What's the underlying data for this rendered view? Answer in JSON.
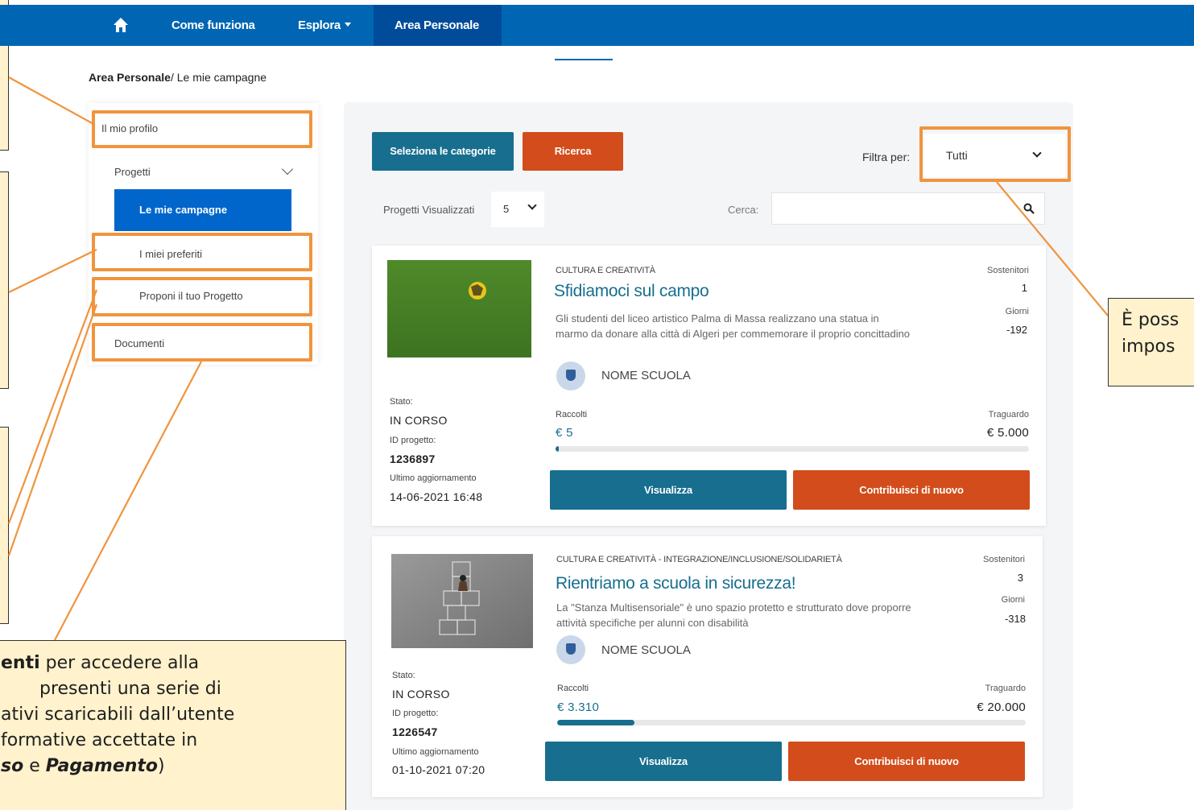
{
  "nav": {
    "home_icon": "home-icon",
    "items": [
      {
        "label": "Come funziona"
      },
      {
        "label": "Esplora"
      },
      {
        "label": "Area Personale"
      }
    ]
  },
  "breadcrumb": {
    "parent": "Area Personale",
    "sep": "/ ",
    "current": "Le mie campagne"
  },
  "sidebar": {
    "items": [
      {
        "label": "Il mio profilo"
      },
      {
        "label": "Progetti"
      },
      {
        "label": "Le mie campagne"
      },
      {
        "label": "I miei preferiti"
      },
      {
        "label": "Proponi il tuo Progetto"
      },
      {
        "label": "Documenti"
      }
    ]
  },
  "toolbar": {
    "categories_button": "Seleziona le categorie",
    "search_button": "Ricerca",
    "filter_label": "Filtra per:",
    "filter_value": "Tutti",
    "shown_label": "Progetti Visualizzati",
    "shown_value": "5",
    "search_label": "Cerca:",
    "search_placeholder": ""
  },
  "projects": [
    {
      "category": "CULTURA E CREATIVITÀ",
      "title": "Sfidiamoci sul campo",
      "description": "Gli studenti del liceo artistico Palma di Massa realizzano una statua in marmo da donare alla città di Algeri per commemorare il proprio concittadino",
      "school": "NOME SCUOLA",
      "supporters_label": "Sostenitori",
      "supporters": "1",
      "days_label": "Giorni",
      "days": "-192",
      "state_label": "Stato:",
      "state": "IN CORSO",
      "id_label": "ID progetto:",
      "id": "1236897",
      "updated_label": "Ultimo aggiornamento",
      "updated": "14-06-2021 16:48",
      "raised_label": "Raccolti",
      "raised": "€ 5",
      "goal_label": "Traguardo",
      "goal": "€ 5.000",
      "progress": 0.001,
      "view_button": "Visualizza",
      "contribute_button": "Contribuisci di nuovo"
    },
    {
      "category": "CULTURA E CREATIVITÀ - INTEGRAZIONE/INCLUSIONE/SOLIDARIETÀ",
      "title": "Rientriamo a scuola in sicurezza!",
      "description": "La \"Stanza Multisensoriale\" è uno spazio protetto e strutturato dove proporre attività specifiche per alunni con disabilità",
      "school": "NOME SCUOLA",
      "supporters_label": "Sostenitori",
      "supporters": "3",
      "days_label": "Giorni",
      "days": "-318",
      "state_label": "Stato:",
      "state": "IN CORSO",
      "id_label": "ID progetto:",
      "id": "1226547",
      "updated_label": "Ultimo aggiornamento",
      "updated": "01-10-2021 07:20",
      "raised_label": "Raccolti",
      "raised": "€ 3.310",
      "goal_label": "Traguardo",
      "goal": "€ 20.000",
      "progress": 0.1655,
      "view_button": "Visualizza",
      "contribute_button": "Contribuisci di nuovo"
    }
  ],
  "callouts": {
    "right_line1": "È poss",
    "right_line2": "impos",
    "bottom_line1_bold": "enti",
    "bottom_line1_rest": " per accedere alla",
    "bottom_line2": "presenti una serie di",
    "bottom_line3": "ativi scaricabili dall’utente",
    "bottom_line4": "formative accettate in",
    "bottom_line5_bold": "so",
    "bottom_line5_mid": " e ",
    "bottom_line5_bold2": "Pagamento",
    "bottom_line5_end": ")"
  },
  "colors": {
    "navbar": "#0066b3",
    "teal": "#176e8e",
    "red": "#d24d1b",
    "callout_border": "#f0943e",
    "note_bg": "#fff2cc"
  }
}
